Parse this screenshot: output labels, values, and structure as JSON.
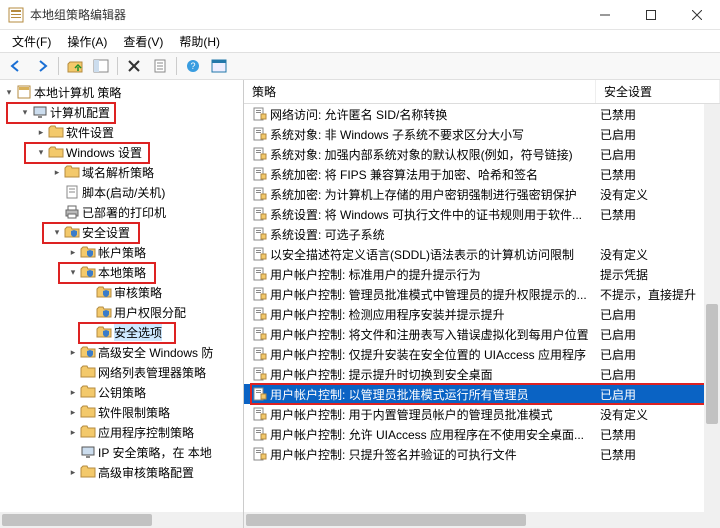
{
  "window": {
    "title": "本地组策略编辑器"
  },
  "menu": {
    "file": "文件(F)",
    "action": "操作(A)",
    "view": "查看(V)",
    "help": "帮助(H)"
  },
  "tree": {
    "root": "本地计算机 策略",
    "computer_config": "计算机配置",
    "software": "软件设置",
    "windows_settings": "Windows 设置",
    "dns_policy": "域名解析策略",
    "scripts": "脚本(启动/关机)",
    "deployed_printers": "已部署的打印机",
    "security_settings": "安全设置",
    "account_policies": "帐户策略",
    "local_policies": "本地策略",
    "audit_policy": "审核策略",
    "user_rights": "用户权限分配",
    "security_options": "安全选项",
    "adv_windows": "高级安全 Windows 防",
    "nlm": "网络列表管理器策略",
    "public_key": "公钥策略",
    "software_restrict": "软件限制策略",
    "app_control": "应用程序控制策略",
    "ip_sec": "IP 安全策略，在 本地",
    "adv_audit": "高级审核策略配置"
  },
  "columns": {
    "policy": "策略",
    "setting": "安全设置"
  },
  "rows": [
    {
      "policy": "网络访问: 允许匿名 SID/名称转换",
      "setting": "已禁用"
    },
    {
      "policy": "系统对象: 非 Windows 子系统不要求区分大小写",
      "setting": "已启用"
    },
    {
      "policy": "系统对象: 加强内部系统对象的默认权限(例如，符号链接)",
      "setting": "已启用"
    },
    {
      "policy": "系统加密: 将 FIPS 兼容算法用于加密、哈希和签名",
      "setting": "已禁用"
    },
    {
      "policy": "系统加密: 为计算机上存储的用户密钥强制进行强密钥保护",
      "setting": "没有定义"
    },
    {
      "policy": "系统设置: 将 Windows 可执行文件中的证书规则用于软件...",
      "setting": "已禁用"
    },
    {
      "policy": "系统设置: 可选子系统",
      "setting": ""
    },
    {
      "policy": "以安全描述符定义语言(SDDL)语法表示的计算机访问限制",
      "setting": "没有定义"
    },
    {
      "policy": "用户帐户控制: 标准用户的提升提示行为",
      "setting": "提示凭据"
    },
    {
      "policy": "用户帐户控制: 管理员批准模式中管理员的提升权限提示的...",
      "setting": "不提示，直接提升"
    },
    {
      "policy": "用户帐户控制: 检测应用程序安装并提示提升",
      "setting": "已启用"
    },
    {
      "policy": "用户帐户控制: 将文件和注册表写入错误虚拟化到每用户位置",
      "setting": "已启用"
    },
    {
      "policy": "用户帐户控制: 仅提升安装在安全位置的 UIAccess 应用程序",
      "setting": "已启用"
    },
    {
      "policy": "用户帐户控制: 提示提升时切换到安全桌面",
      "setting": "已启用"
    },
    {
      "policy": "用户帐户控制: 以管理员批准模式运行所有管理员",
      "setting": "已启用",
      "selected": true
    },
    {
      "policy": "用户帐户控制: 用于内置管理员帐户的管理员批准模式",
      "setting": "没有定义"
    },
    {
      "policy": "用户帐户控制: 允许 UIAccess 应用程序在不使用安全桌面...",
      "setting": "已禁用"
    },
    {
      "policy": "用户帐户控制: 只提升签名并验证的可执行文件",
      "setting": "已禁用"
    }
  ]
}
